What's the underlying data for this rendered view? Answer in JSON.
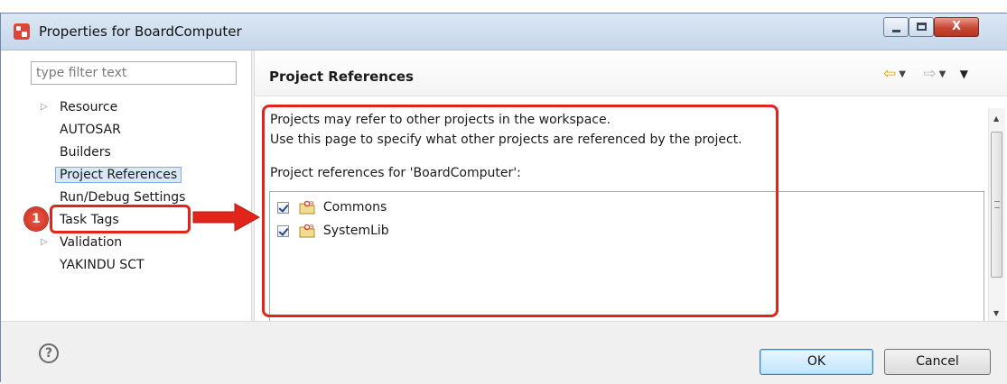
{
  "window": {
    "title": "Properties for BoardComputer",
    "close_label": "X"
  },
  "filter": {
    "placeholder": "type filter text"
  },
  "tree": {
    "items": [
      {
        "label": "Resource",
        "expandable": true
      },
      {
        "label": "AUTOSAR",
        "expandable": false
      },
      {
        "label": "Builders",
        "expandable": false
      },
      {
        "label": "Project References",
        "expandable": false,
        "selected": true
      },
      {
        "label": "Run/Debug Settings",
        "expandable": false
      },
      {
        "label": "Task Tags",
        "expandable": false
      },
      {
        "label": "Validation",
        "expandable": true
      },
      {
        "label": "YAKINDU SCT",
        "expandable": false
      }
    ]
  },
  "annotation": {
    "step_number": "1",
    "highlight_color": "#e1251b"
  },
  "page": {
    "title": "Project References",
    "description_line1": "Projects may refer to other projects in the workspace.",
    "description_line2": "Use this page to specify what other projects are referenced by the project.",
    "references_label": "Project references for 'BoardComputer':",
    "references": [
      {
        "name": "Commons",
        "checked": true
      },
      {
        "name": "SystemLib",
        "checked": true
      }
    ]
  },
  "icons": {
    "app": "properties-dialog-icon",
    "project": "project-folder-icon",
    "back": "back-arrow-icon",
    "forward": "forward-arrow-icon",
    "help": "help-icon"
  },
  "footer": {
    "ok_label": "OK",
    "cancel_label": "Cancel",
    "help_glyph": "?"
  }
}
